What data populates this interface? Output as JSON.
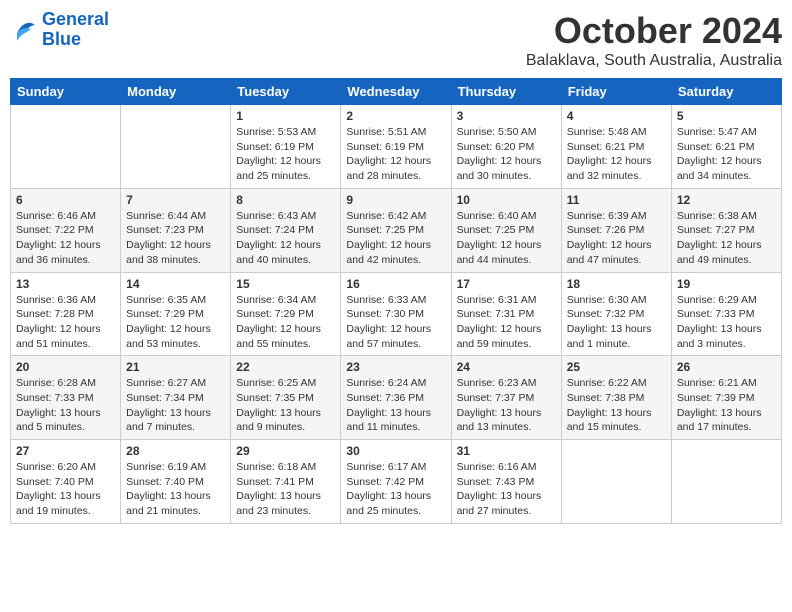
{
  "header": {
    "logo_line1": "General",
    "logo_line2": "Blue",
    "month": "October 2024",
    "location": "Balaklava, South Australia, Australia"
  },
  "days_of_week": [
    "Sunday",
    "Monday",
    "Tuesday",
    "Wednesday",
    "Thursday",
    "Friday",
    "Saturday"
  ],
  "weeks": [
    [
      {
        "day": "",
        "info": ""
      },
      {
        "day": "",
        "info": ""
      },
      {
        "day": "1",
        "info": "Sunrise: 5:53 AM\nSunset: 6:19 PM\nDaylight: 12 hours\nand 25 minutes."
      },
      {
        "day": "2",
        "info": "Sunrise: 5:51 AM\nSunset: 6:19 PM\nDaylight: 12 hours\nand 28 minutes."
      },
      {
        "day": "3",
        "info": "Sunrise: 5:50 AM\nSunset: 6:20 PM\nDaylight: 12 hours\nand 30 minutes."
      },
      {
        "day": "4",
        "info": "Sunrise: 5:48 AM\nSunset: 6:21 PM\nDaylight: 12 hours\nand 32 minutes."
      },
      {
        "day": "5",
        "info": "Sunrise: 5:47 AM\nSunset: 6:21 PM\nDaylight: 12 hours\nand 34 minutes."
      }
    ],
    [
      {
        "day": "6",
        "info": "Sunrise: 6:46 AM\nSunset: 7:22 PM\nDaylight: 12 hours\nand 36 minutes."
      },
      {
        "day": "7",
        "info": "Sunrise: 6:44 AM\nSunset: 7:23 PM\nDaylight: 12 hours\nand 38 minutes."
      },
      {
        "day": "8",
        "info": "Sunrise: 6:43 AM\nSunset: 7:24 PM\nDaylight: 12 hours\nand 40 minutes."
      },
      {
        "day": "9",
        "info": "Sunrise: 6:42 AM\nSunset: 7:25 PM\nDaylight: 12 hours\nand 42 minutes."
      },
      {
        "day": "10",
        "info": "Sunrise: 6:40 AM\nSunset: 7:25 PM\nDaylight: 12 hours\nand 44 minutes."
      },
      {
        "day": "11",
        "info": "Sunrise: 6:39 AM\nSunset: 7:26 PM\nDaylight: 12 hours\nand 47 minutes."
      },
      {
        "day": "12",
        "info": "Sunrise: 6:38 AM\nSunset: 7:27 PM\nDaylight: 12 hours\nand 49 minutes."
      }
    ],
    [
      {
        "day": "13",
        "info": "Sunrise: 6:36 AM\nSunset: 7:28 PM\nDaylight: 12 hours\nand 51 minutes."
      },
      {
        "day": "14",
        "info": "Sunrise: 6:35 AM\nSunset: 7:29 PM\nDaylight: 12 hours\nand 53 minutes."
      },
      {
        "day": "15",
        "info": "Sunrise: 6:34 AM\nSunset: 7:29 PM\nDaylight: 12 hours\nand 55 minutes."
      },
      {
        "day": "16",
        "info": "Sunrise: 6:33 AM\nSunset: 7:30 PM\nDaylight: 12 hours\nand 57 minutes."
      },
      {
        "day": "17",
        "info": "Sunrise: 6:31 AM\nSunset: 7:31 PM\nDaylight: 12 hours\nand 59 minutes."
      },
      {
        "day": "18",
        "info": "Sunrise: 6:30 AM\nSunset: 7:32 PM\nDaylight: 13 hours\nand 1 minute."
      },
      {
        "day": "19",
        "info": "Sunrise: 6:29 AM\nSunset: 7:33 PM\nDaylight: 13 hours\nand 3 minutes."
      }
    ],
    [
      {
        "day": "20",
        "info": "Sunrise: 6:28 AM\nSunset: 7:33 PM\nDaylight: 13 hours\nand 5 minutes."
      },
      {
        "day": "21",
        "info": "Sunrise: 6:27 AM\nSunset: 7:34 PM\nDaylight: 13 hours\nand 7 minutes."
      },
      {
        "day": "22",
        "info": "Sunrise: 6:25 AM\nSunset: 7:35 PM\nDaylight: 13 hours\nand 9 minutes."
      },
      {
        "day": "23",
        "info": "Sunrise: 6:24 AM\nSunset: 7:36 PM\nDaylight: 13 hours\nand 11 minutes."
      },
      {
        "day": "24",
        "info": "Sunrise: 6:23 AM\nSunset: 7:37 PM\nDaylight: 13 hours\nand 13 minutes."
      },
      {
        "day": "25",
        "info": "Sunrise: 6:22 AM\nSunset: 7:38 PM\nDaylight: 13 hours\nand 15 minutes."
      },
      {
        "day": "26",
        "info": "Sunrise: 6:21 AM\nSunset: 7:39 PM\nDaylight: 13 hours\nand 17 minutes."
      }
    ],
    [
      {
        "day": "27",
        "info": "Sunrise: 6:20 AM\nSunset: 7:40 PM\nDaylight: 13 hours\nand 19 minutes."
      },
      {
        "day": "28",
        "info": "Sunrise: 6:19 AM\nSunset: 7:40 PM\nDaylight: 13 hours\nand 21 minutes."
      },
      {
        "day": "29",
        "info": "Sunrise: 6:18 AM\nSunset: 7:41 PM\nDaylight: 13 hours\nand 23 minutes."
      },
      {
        "day": "30",
        "info": "Sunrise: 6:17 AM\nSunset: 7:42 PM\nDaylight: 13 hours\nand 25 minutes."
      },
      {
        "day": "31",
        "info": "Sunrise: 6:16 AM\nSunset: 7:43 PM\nDaylight: 13 hours\nand 27 minutes."
      },
      {
        "day": "",
        "info": ""
      },
      {
        "day": "",
        "info": ""
      }
    ]
  ]
}
